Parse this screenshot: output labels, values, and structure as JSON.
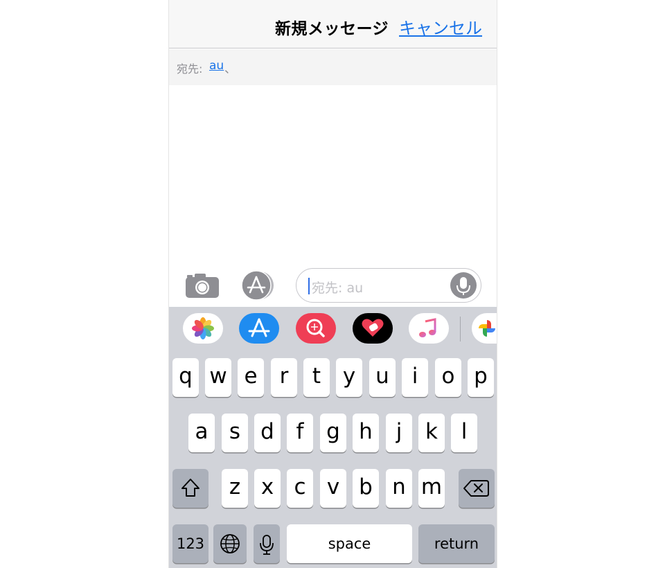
{
  "header": {
    "title": "新規メッセージ",
    "cancel_label": "キャンセル"
  },
  "recipient": {
    "label": "宛先:",
    "name": "au",
    "separator": "、"
  },
  "compose": {
    "placeholder": "宛先: au"
  },
  "app_strip": {
    "items": [
      "photos-icon",
      "app-store-icon",
      "web-search-icon",
      "digital-touch-icon",
      "music-icon",
      "google-photos-icon"
    ]
  },
  "keyboard": {
    "row1": [
      "q",
      "w",
      "e",
      "r",
      "t",
      "y",
      "u",
      "i",
      "o",
      "p"
    ],
    "row2": [
      "a",
      "s",
      "d",
      "f",
      "g",
      "h",
      "j",
      "k",
      "l"
    ],
    "row3": [
      "z",
      "x",
      "c",
      "v",
      "b",
      "n",
      "m"
    ],
    "numbers_label": "123",
    "space_label": "space",
    "return_label": "return"
  },
  "colors": {
    "link_blue": "#1a73e8",
    "keyboard_bg": "#d1d3d9",
    "dark_key": "#abb0ba"
  }
}
